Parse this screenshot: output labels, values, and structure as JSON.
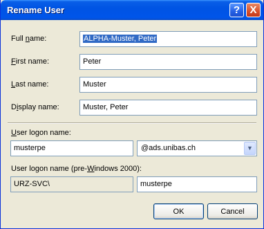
{
  "window": {
    "title": "Rename User"
  },
  "title_buttons": {
    "help": "?",
    "close": "X"
  },
  "form": {
    "full_name": {
      "pre": "Full ",
      "key": "n",
      "post": "ame:",
      "value": "ALPHA-Muster, Peter"
    },
    "first_name": {
      "pre": "",
      "key": "F",
      "post": "irst name:",
      "value": "Peter"
    },
    "last_name": {
      "pre": "",
      "key": "L",
      "post": "ast name:",
      "value": "Muster"
    },
    "display_name": {
      "pre": "D",
      "key": "i",
      "post": "splay name:",
      "value": "Muster, Peter"
    }
  },
  "logon": {
    "label_pre": "",
    "label_key": "U",
    "label_post": "ser logon name:",
    "value": "musterpe",
    "domain": "@ads.unibas.ch"
  },
  "logon_pre2000": {
    "label_pre": "User logon name (pre-",
    "label_key": "W",
    "label_post": "indows 2000):",
    "domain_prefix": "URZ-SVC\\",
    "value": "musterpe"
  },
  "buttons": {
    "ok": "OK",
    "cancel": "Cancel"
  }
}
